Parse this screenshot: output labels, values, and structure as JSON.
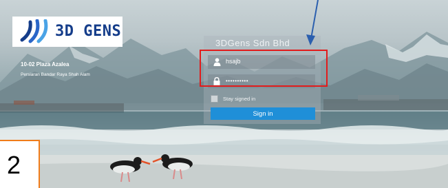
{
  "logo": {
    "text": "3D GENS"
  },
  "address": {
    "line1": "10-02 Plaza Azalea",
    "line2": "Persiaran Bandar Raya Shah Alam"
  },
  "login": {
    "company": "3DGens Sdn Bhd",
    "username_value": "hsajb",
    "password_value": "••••••••••",
    "stay_signed_in": "Stay signed in",
    "signin_label": "Sign in"
  },
  "annotation": {
    "step_number": "2",
    "highlight_color": "#e21b1b",
    "arrow_color": "#2b5fae"
  },
  "colors": {
    "signin_button": "#1f8fd8",
    "logo_text": "#153d8a",
    "step_border": "#f07c1a"
  },
  "icons": [
    "user-icon",
    "lock-icon",
    "arrow-icon"
  ]
}
